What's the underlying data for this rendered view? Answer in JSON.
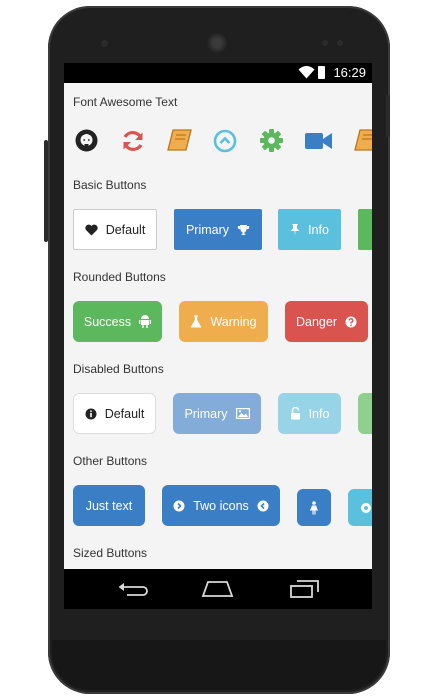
{
  "status": {
    "time": "16:29"
  },
  "sections": {
    "font_awesome": "Font Awesome Text",
    "basic": "Basic Buttons",
    "rounded": "Rounded Buttons",
    "disabled": "Disabled Buttons",
    "other": "Other Buttons",
    "sized": "Sized Buttons"
  },
  "font_awesome_icons": [
    "github-icon",
    "refresh-icon",
    "book-icon",
    "chevron-circle-up-icon",
    "gear-icon",
    "video-camera-icon",
    "book-icon"
  ],
  "basic_buttons": {
    "default": "Default",
    "primary": "Primary",
    "info": "Info"
  },
  "rounded_buttons": {
    "success": "Success",
    "warning": "Warning",
    "danger": "Danger"
  },
  "disabled_buttons": {
    "default": "Default",
    "primary": "Primary",
    "info": "Info"
  },
  "other_buttons": {
    "just_text": "Just text",
    "two_icons": "Two icons"
  },
  "colors": {
    "default": "#ffffff",
    "primary": "#3a7fc6",
    "info": "#5bc0de",
    "success": "#5cb85c",
    "warning": "#f0ad4e",
    "danger": "#d9534f",
    "primary_disabled": "#84acd9",
    "info_disabled": "#98d4e8",
    "success_disabled": "#8fd08f"
  }
}
